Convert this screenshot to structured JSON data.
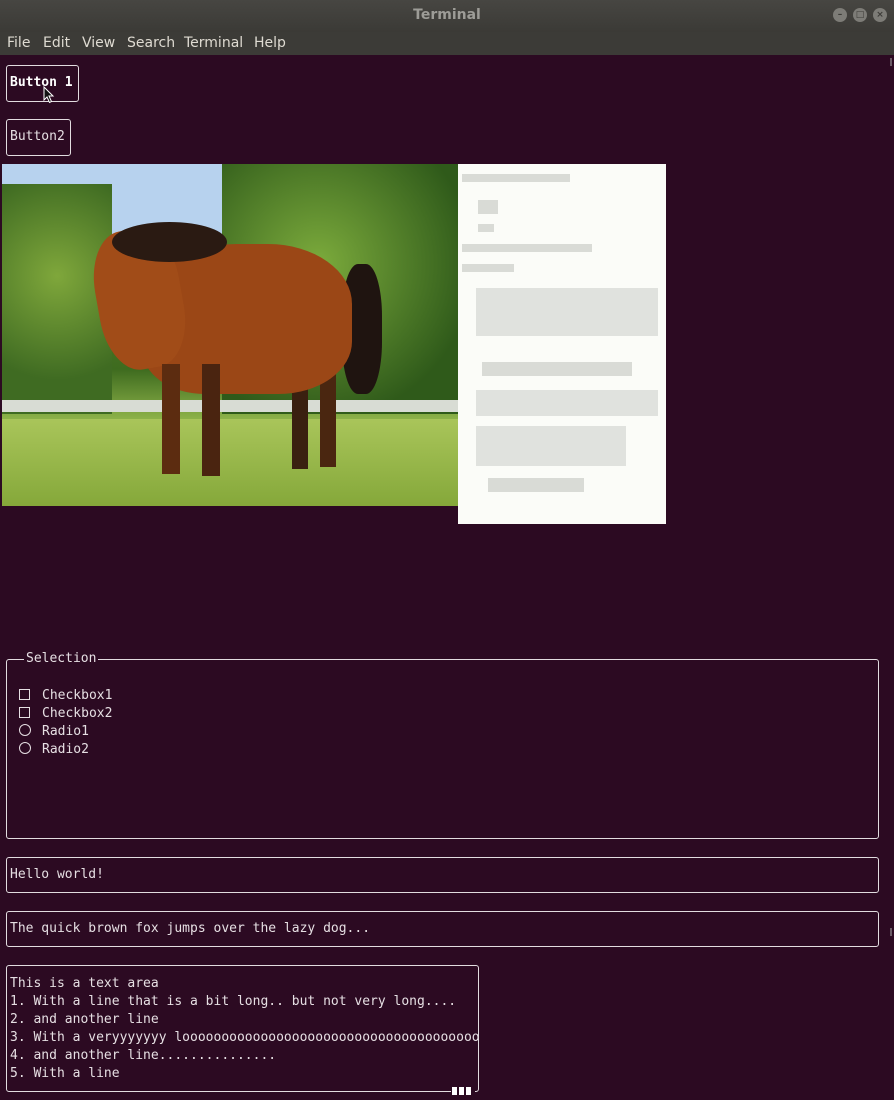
{
  "window": {
    "title": "Terminal"
  },
  "menubar": {
    "items": [
      "File",
      "Edit",
      "View",
      "Search",
      "Terminal",
      "Help"
    ]
  },
  "buttons": {
    "button1": "Button 1",
    "button2": "Button2"
  },
  "selection": {
    "legend": "Selection",
    "checkboxes": [
      "Checkbox1",
      "Checkbox2"
    ],
    "radios": [
      "Radio1",
      "Radio2"
    ]
  },
  "inputs": {
    "hello": "Hello world!",
    "fox": "The quick brown fox jumps over the lazy dog..."
  },
  "textarea": {
    "lines": [
      "This is a text area",
      "1. With a line that is a bit long.. but not very long....",
      "2. and another line",
      "3. With a veryyyyyyy looooooooooooooooooooooooooooooooooooooo",
      "4. and another line...............",
      "5. With a line"
    ]
  },
  "colors": {
    "terminal_bg": "#2c0a22",
    "titlebar": "#3c3b37",
    "widget_border": "#e2dce0"
  },
  "icons": {
    "minimize": "minimize-icon",
    "maximize": "maximize-icon",
    "close": "close-icon",
    "checkbox": "checkbox-icon",
    "radio": "radio-icon",
    "pointer": "mouse-pointer-icon"
  }
}
